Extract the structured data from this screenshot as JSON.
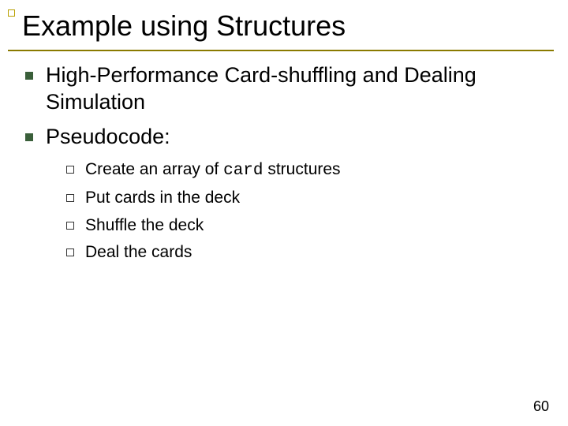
{
  "title": "Example using Structures",
  "bullets": [
    {
      "text": "High-Performance Card-shuffling and Dealing Simulation"
    },
    {
      "text": "Pseudocode:",
      "sub": [
        {
          "pre": "Create an array of ",
          "code": "card",
          "post": " structures"
        },
        {
          "pre": "Put cards in the deck"
        },
        {
          "pre": "Shuffle the deck"
        },
        {
          "pre": "Deal the cards"
        }
      ]
    }
  ],
  "page_number": "60"
}
